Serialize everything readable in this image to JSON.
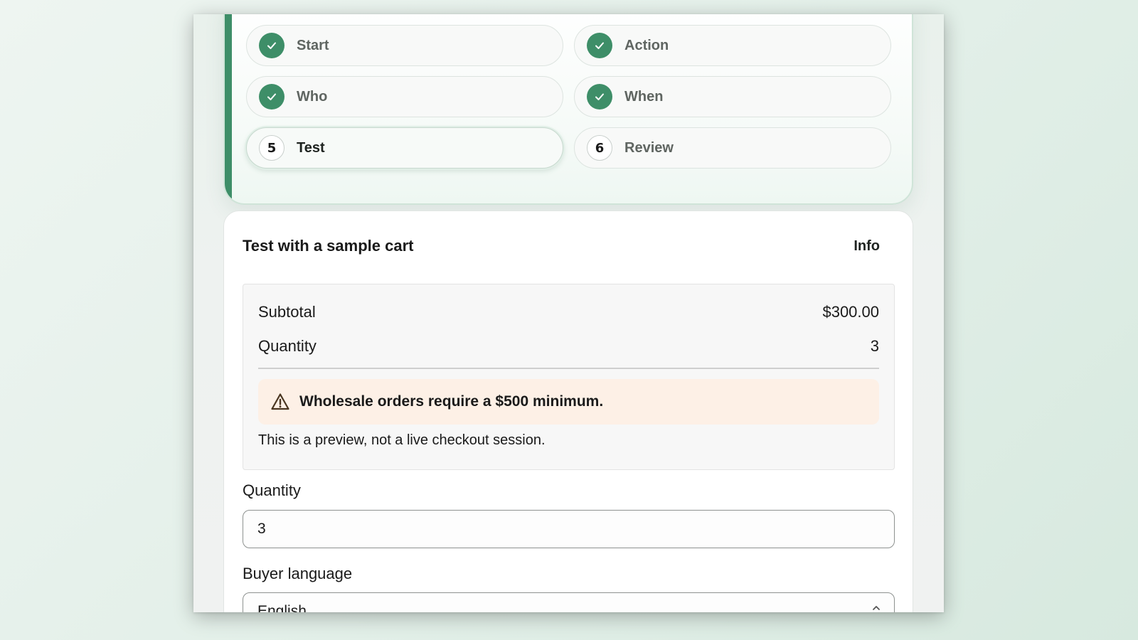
{
  "stepper": {
    "steps": [
      {
        "label": "Start",
        "status": "complete",
        "icon": "check-icon"
      },
      {
        "label": "Action",
        "status": "complete",
        "icon": "check-icon"
      },
      {
        "label": "Who",
        "status": "complete",
        "icon": "check-icon"
      },
      {
        "label": "When",
        "status": "complete",
        "icon": "check-icon"
      },
      {
        "label": "Test",
        "status": "current",
        "number": "5"
      },
      {
        "label": "Review",
        "status": "upcoming",
        "number": "6"
      }
    ]
  },
  "test_card": {
    "title": "Test with a sample cart",
    "info_link": "Info",
    "summary": {
      "subtotal_label": "Subtotal",
      "subtotal_value": "$300.00",
      "quantity_label": "Quantity",
      "quantity_value": "3"
    },
    "warning": {
      "icon": "warning-triangle-icon",
      "text": "Wholesale orders require a $500 minimum."
    },
    "preview_note": "This is a preview, not a live checkout session.",
    "quantity_field": {
      "label": "Quantity",
      "value": "3"
    },
    "buyer_language": {
      "label": "Buyer language",
      "selected": "English"
    }
  },
  "colors": {
    "accent_green": "#3e8e68",
    "warning_bg": "#fdf0e6"
  }
}
